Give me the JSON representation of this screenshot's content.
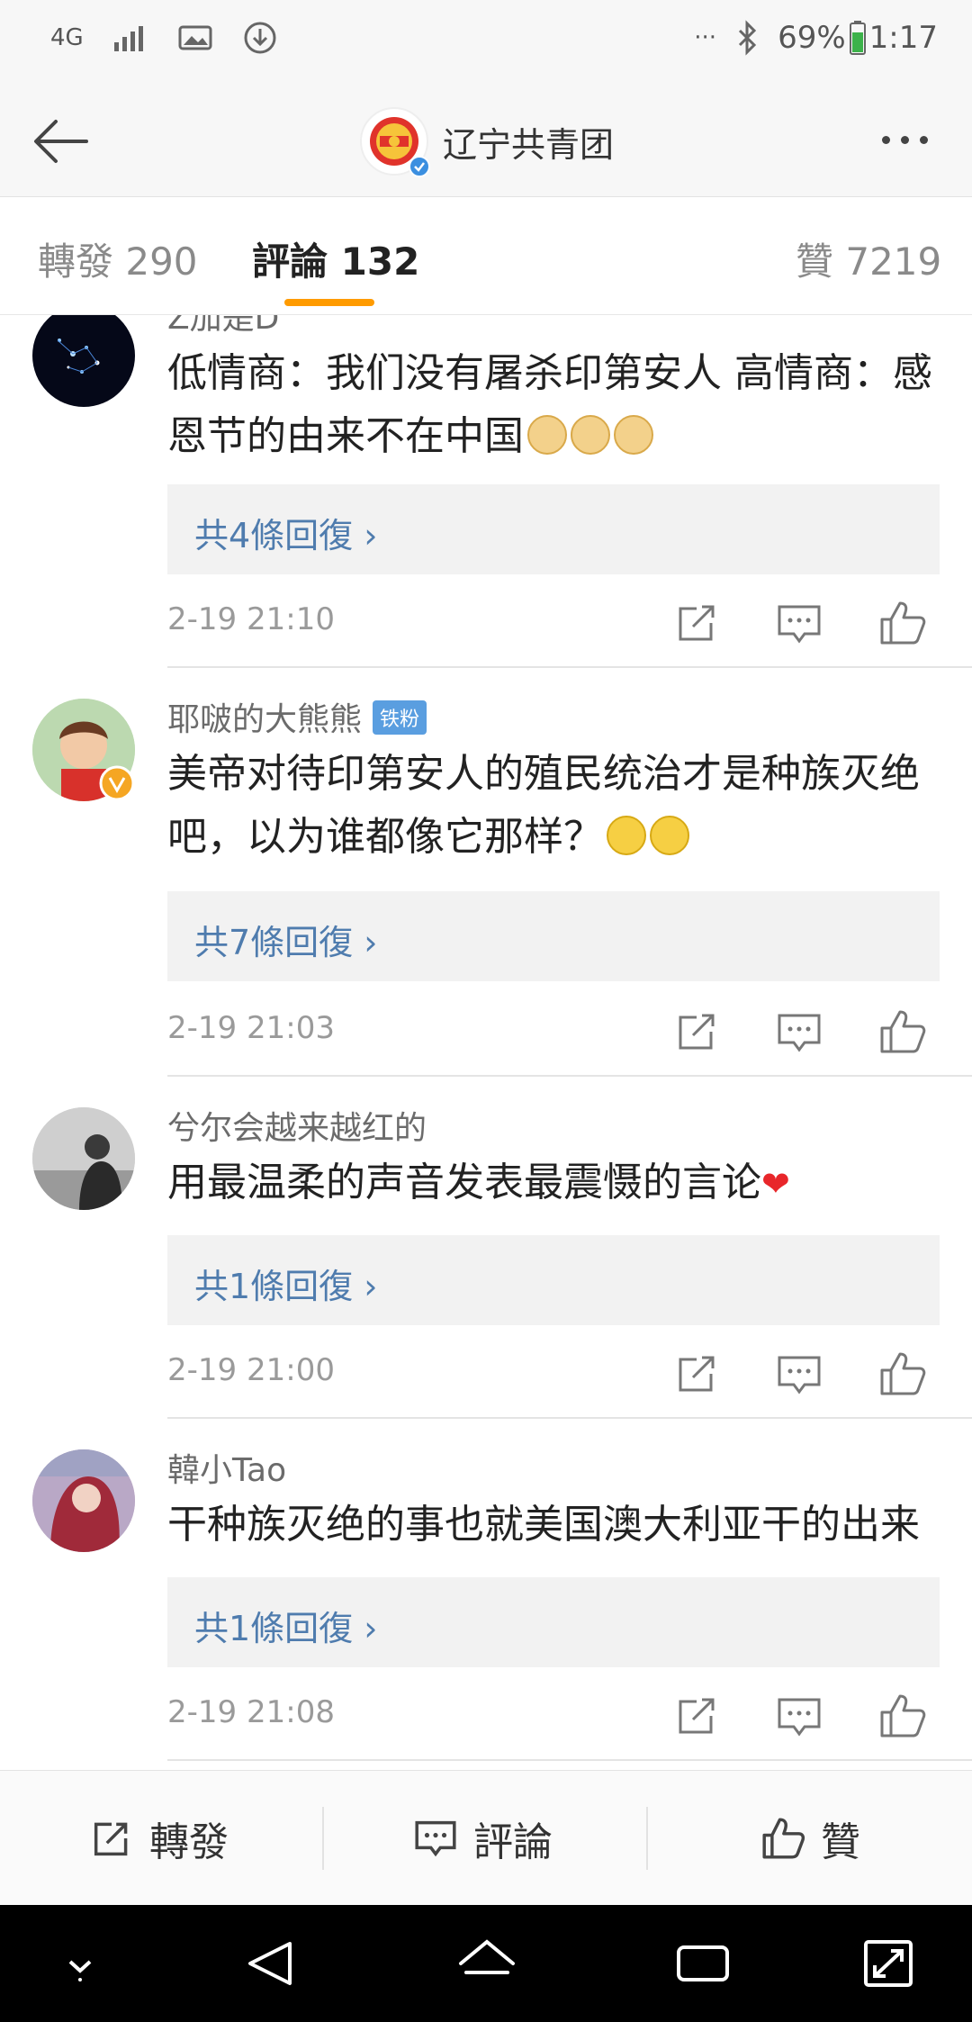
{
  "status": {
    "network": "4G",
    "battery": "69%",
    "time": "1:17",
    "more": "···"
  },
  "nav": {
    "title": "辽宁共青团"
  },
  "tabs": [
    {
      "label": "轉發 290"
    },
    {
      "label": "評論 132"
    },
    {
      "label": "贊 7219"
    }
  ],
  "comments": [
    {
      "user": "Z加是D",
      "text": "低情商：我们没有屠杀印第安人 高情商：感恩节的由来不在中国",
      "replies": "共4條回復 ›",
      "time": "2-19 21:10"
    },
    {
      "user": "耶啵的大熊熊",
      "badge": "铁粉",
      "text": "美帝对待印第安人的殖民统治才是种族灭绝吧，以为谁都像它那样？",
      "replies": "共7條回復 ›",
      "time": "2-19 21:03"
    },
    {
      "user": "兮尔会越来越红的",
      "text": "用最温柔的声音发表最震慑的言论",
      "replies": "共1條回復 ›",
      "time": "2-19 21:00"
    },
    {
      "user": "韓小Tao",
      "text": "干种族灭绝的事也就美国澳大利亚干的出来",
      "replies": "共1條回復 ›",
      "time": "2-19 21:08"
    }
  ],
  "bottom": {
    "repost": "轉發",
    "comment": "評論",
    "like": "贊"
  },
  "colors": {
    "accent": "#ff9b00",
    "link": "#4f7cae",
    "badge": "#5a9ee0"
  }
}
